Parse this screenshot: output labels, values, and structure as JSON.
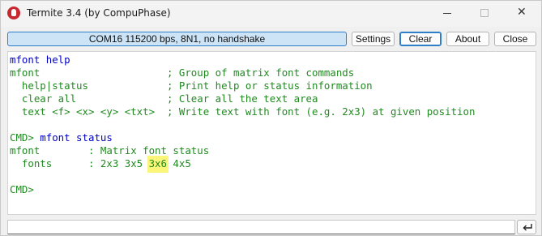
{
  "window": {
    "title": "Termite 3.4 (by CompuPhase)",
    "min_glyph": "",
    "close_glyph": "✕"
  },
  "toolbar": {
    "status": "COM16 115200 bps, 8N1, no handshake",
    "settings_label": "Settings",
    "clear_label": "Clear",
    "about_label": "About",
    "close_label": "Close"
  },
  "terminal": {
    "lines": [
      {
        "kind": "sent",
        "text": "mfont help"
      },
      {
        "kind": "recv",
        "text": "mfont                     ; Group of matrix font commands"
      },
      {
        "kind": "recv",
        "text": "  help|status             ; Print help or status information"
      },
      {
        "kind": "recv",
        "text": "  clear all               ; Clear all the text area"
      },
      {
        "kind": "recv",
        "text": "  text <f> <x> <y> <txt>  ; Write text with font (e.g. 2x3) at given position"
      },
      {
        "kind": "recv",
        "text": ""
      },
      {
        "kind": "mixed",
        "prompt": "CMD>",
        "command": " mfont status"
      },
      {
        "kind": "recv",
        "text": "mfont        : Matrix font status"
      },
      {
        "kind": "fonts",
        "prefix": "  fonts      : 2x3 3x5 ",
        "highlight": "3x6",
        "suffix": " 4x5"
      },
      {
        "kind": "recv",
        "text": ""
      },
      {
        "kind": "recv",
        "text": "CMD>"
      }
    ]
  },
  "input": {
    "value": "",
    "send_icon": "enter-icon"
  },
  "colors": {
    "sent_text": "#0000c8",
    "received_text": "#208a20",
    "highlight": "#fbf57a",
    "status_bg": "#cde4f7"
  }
}
